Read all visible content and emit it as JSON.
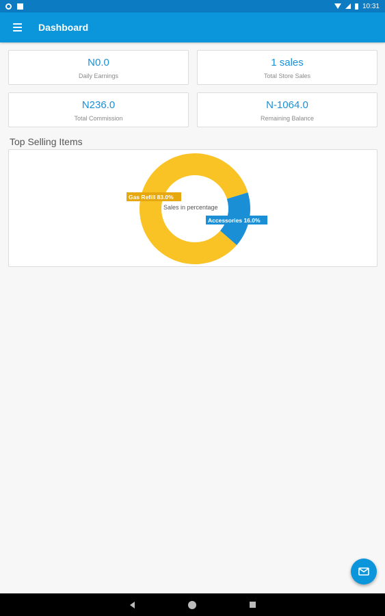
{
  "status_bar": {
    "time": "10:31"
  },
  "app_bar": {
    "title": "Dashboard",
    "menu_icon": "menu-icon"
  },
  "cards": [
    {
      "value": "N0.0",
      "label": "Daily Earnings"
    },
    {
      "value": "1 sales",
      "label": "Total Store Sales"
    },
    {
      "value": "N236.0",
      "label": "Total Commission"
    },
    {
      "value": "N-1064.0",
      "label": "Remaining Balance"
    }
  ],
  "section": {
    "title": "Top Selling Items"
  },
  "chart_data": {
    "type": "pie",
    "donut": true,
    "center_label": "Sales in  percentage",
    "slices": [
      {
        "name": "Gas Refill",
        "value": 83.0,
        "label": "Gas Refill 83.0%",
        "color": "#f9c325"
      },
      {
        "name": "Accessories",
        "value": 16.0,
        "label": "Accessories 16.0%",
        "color": "#1a8fd6"
      }
    ]
  },
  "fab": {
    "icon": "mail-icon"
  },
  "colors": {
    "status_bar": "#0d7bc2",
    "app_bar": "#0b96dc",
    "accent_text": "#1a8fd6"
  }
}
